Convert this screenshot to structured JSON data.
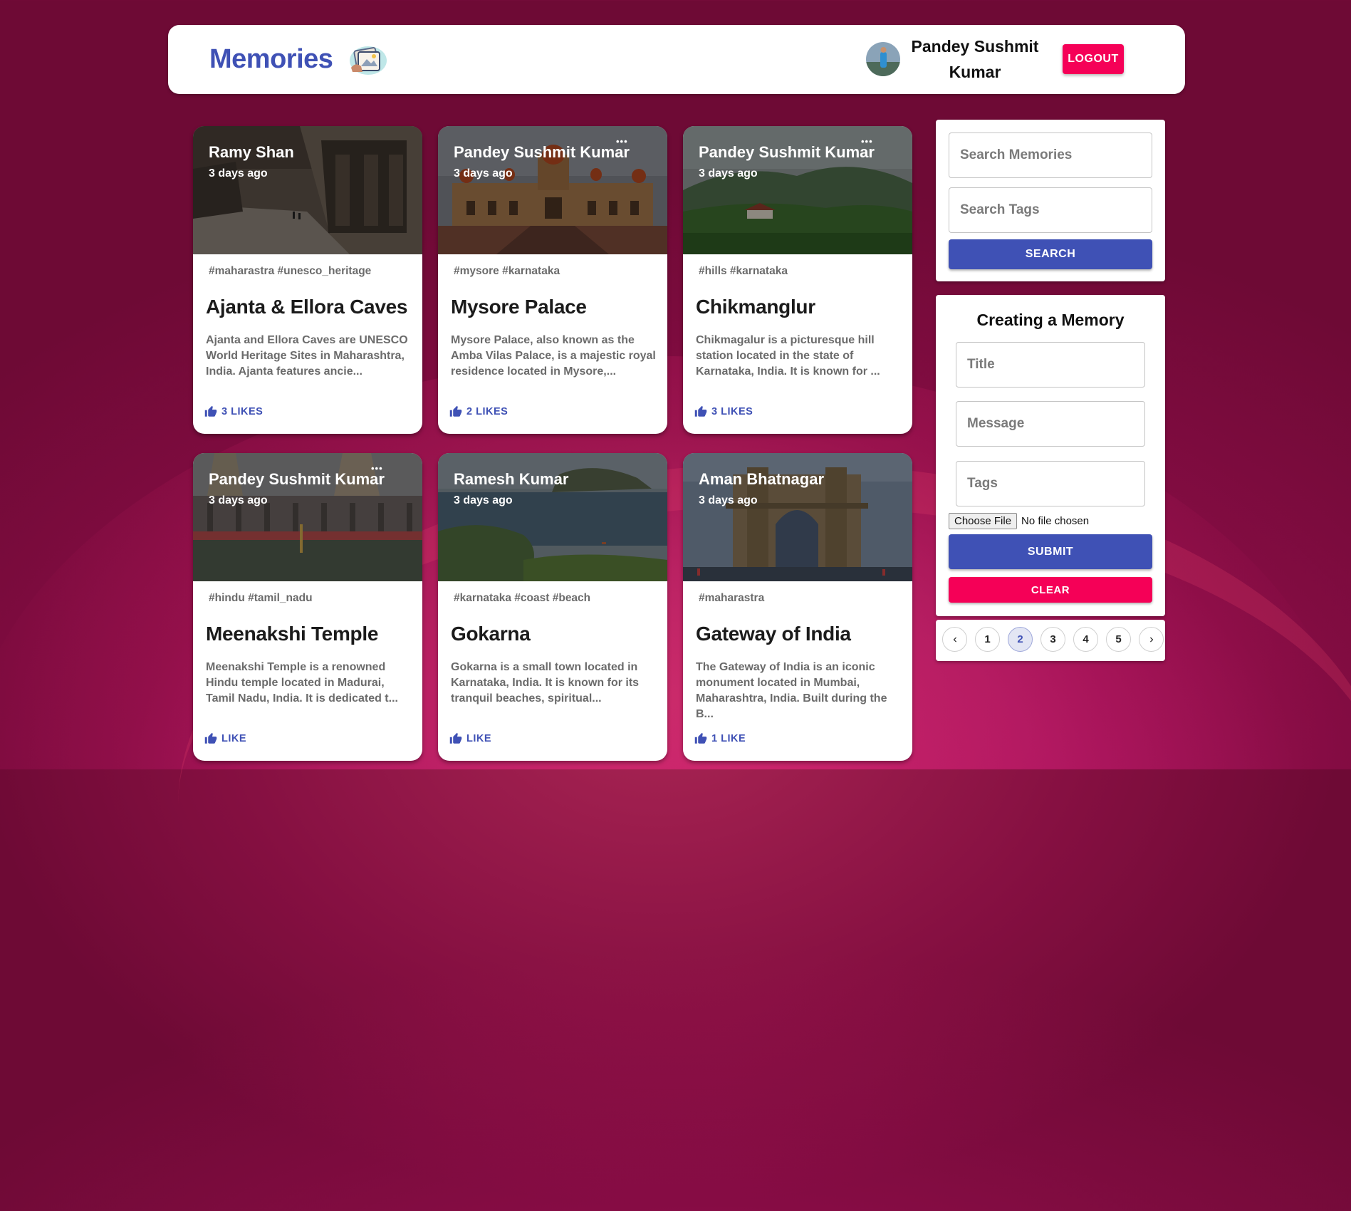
{
  "app": {
    "title": "Memories",
    "user_name": "Pandey Sushmit Kumar",
    "logout_label": "LOGOUT"
  },
  "posts": [
    {
      "author": "Ramy Shan",
      "time": "3 days ago",
      "tags": "#maharastra #unesco_heritage",
      "title": "Ajanta & Ellora Caves",
      "message": "Ajanta and Ellora Caves are UNESCO World Heritage Sites in Maharashtra, India. Ajanta features ancie...",
      "likes": "3 LIKES",
      "has_menu": false,
      "image": "caves"
    },
    {
      "author": "Pandey Sushmit Kumar",
      "time": "3 days ago",
      "tags": "#mysore #karnataka",
      "title": "Mysore Palace",
      "message": "Mysore Palace, also known as the Amba Vilas Palace, is a majestic royal residence located in Mysore,...",
      "likes": "2 LIKES",
      "has_menu": true,
      "image": "palace"
    },
    {
      "author": "Pandey Sushmit Kumar",
      "time": "3 days ago",
      "tags": "#hills #karnataka",
      "title": "Chikmanglur",
      "message": "Chikmagalur is a picturesque hill station located in the state of Karnataka, India. It is known for ...",
      "likes": "3 LIKES",
      "has_menu": true,
      "image": "hills"
    },
    {
      "author": "Pandey Sushmit Kumar",
      "time": "3 days ago",
      "tags": "#hindu #tamil_nadu",
      "title": "Meenakshi Temple",
      "message": "Meenakshi Temple is a renowned Hindu temple located in Madurai, Tamil Nadu, India. It is dedicated t...",
      "likes": "LIKE",
      "has_menu": true,
      "image": "temple"
    },
    {
      "author": "Ramesh Kumar",
      "time": "3 days ago",
      "tags": "#karnataka #coast #beach",
      "title": "Gokarna",
      "message": "Gokarna is a small town located in Karnataka, India. It is known for its tranquil beaches, spiritual...",
      "likes": "LIKE",
      "has_menu": false,
      "image": "coast"
    },
    {
      "author": "Aman Bhatnagar",
      "time": "3 days ago",
      "tags": "#maharastra",
      "title": "Gateway of India",
      "message": "The Gateway of India is an iconic monument located in Mumbai, Maharashtra, India. Built during the B...",
      "likes": "1 LIKE",
      "has_menu": false,
      "image": "gateway"
    }
  ],
  "search": {
    "memories_placeholder": "Search Memories",
    "tags_placeholder": "Search Tags",
    "button_label": "SEARCH"
  },
  "form": {
    "heading": "Creating a Memory",
    "title_placeholder": "Title",
    "message_placeholder": "Message",
    "tags_placeholder": "Tags",
    "file_button": "Choose File",
    "file_status": "No file chosen",
    "submit_label": "SUBMIT",
    "clear_label": "CLEAR"
  },
  "pagination": {
    "pages": [
      "1",
      "2",
      "3",
      "4",
      "5"
    ],
    "current": "2",
    "prev_icon": "chevron-left-icon",
    "next_icon": "chevron-right-icon"
  },
  "colors": {
    "primary": "#3f51b5",
    "secondary": "#f50057"
  }
}
